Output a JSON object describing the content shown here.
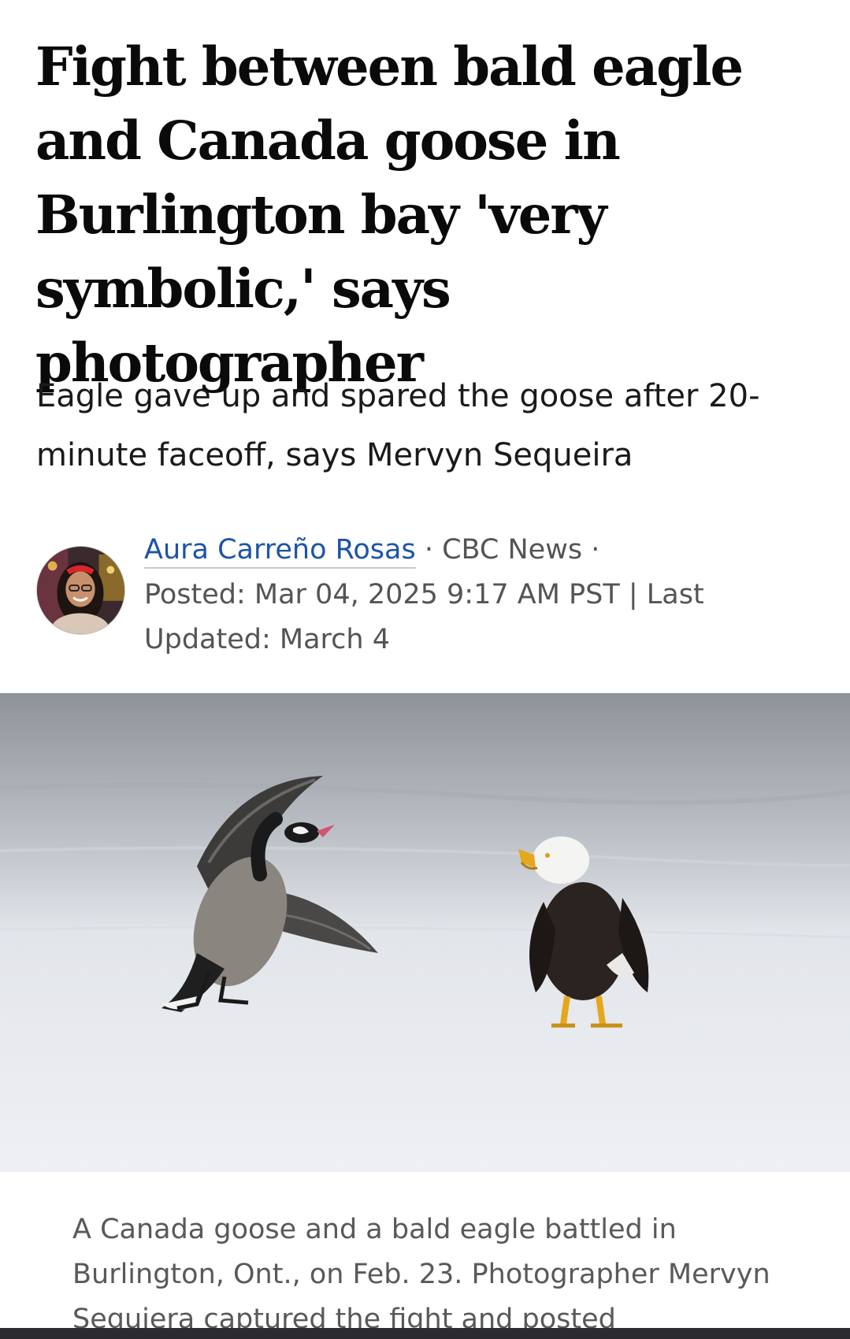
{
  "article": {
    "headline": "Fight between bald eagle and Canada goose in Burlington bay 'very symbolic,' says photographer",
    "deck": "Eagle gave up and spared the goose after 20-minute faceoff, says Mervyn Sequeira",
    "byline": {
      "author": "Aura Carreño Rosas",
      "separator_1": " · ",
      "outlet": "CBC News",
      "separator_2": " · ",
      "posted": "Posted: Mar 04, 2025 9:17 AM PST | Last Updated: March 4",
      "avatar_icon": "author-avatar"
    },
    "photo": {
      "icon": "eagle-goose-photo"
    },
    "caption": "A Canada goose and a bald eagle battled in Burlington, Ont., on Feb. 23. Photographer Mervyn Sequiera captured the fight and posted"
  },
  "colors": {
    "link": "#1d54a6",
    "meta_text": "#545454",
    "caption_text": "#595959",
    "bottom_bar": "#2b2b2f"
  }
}
